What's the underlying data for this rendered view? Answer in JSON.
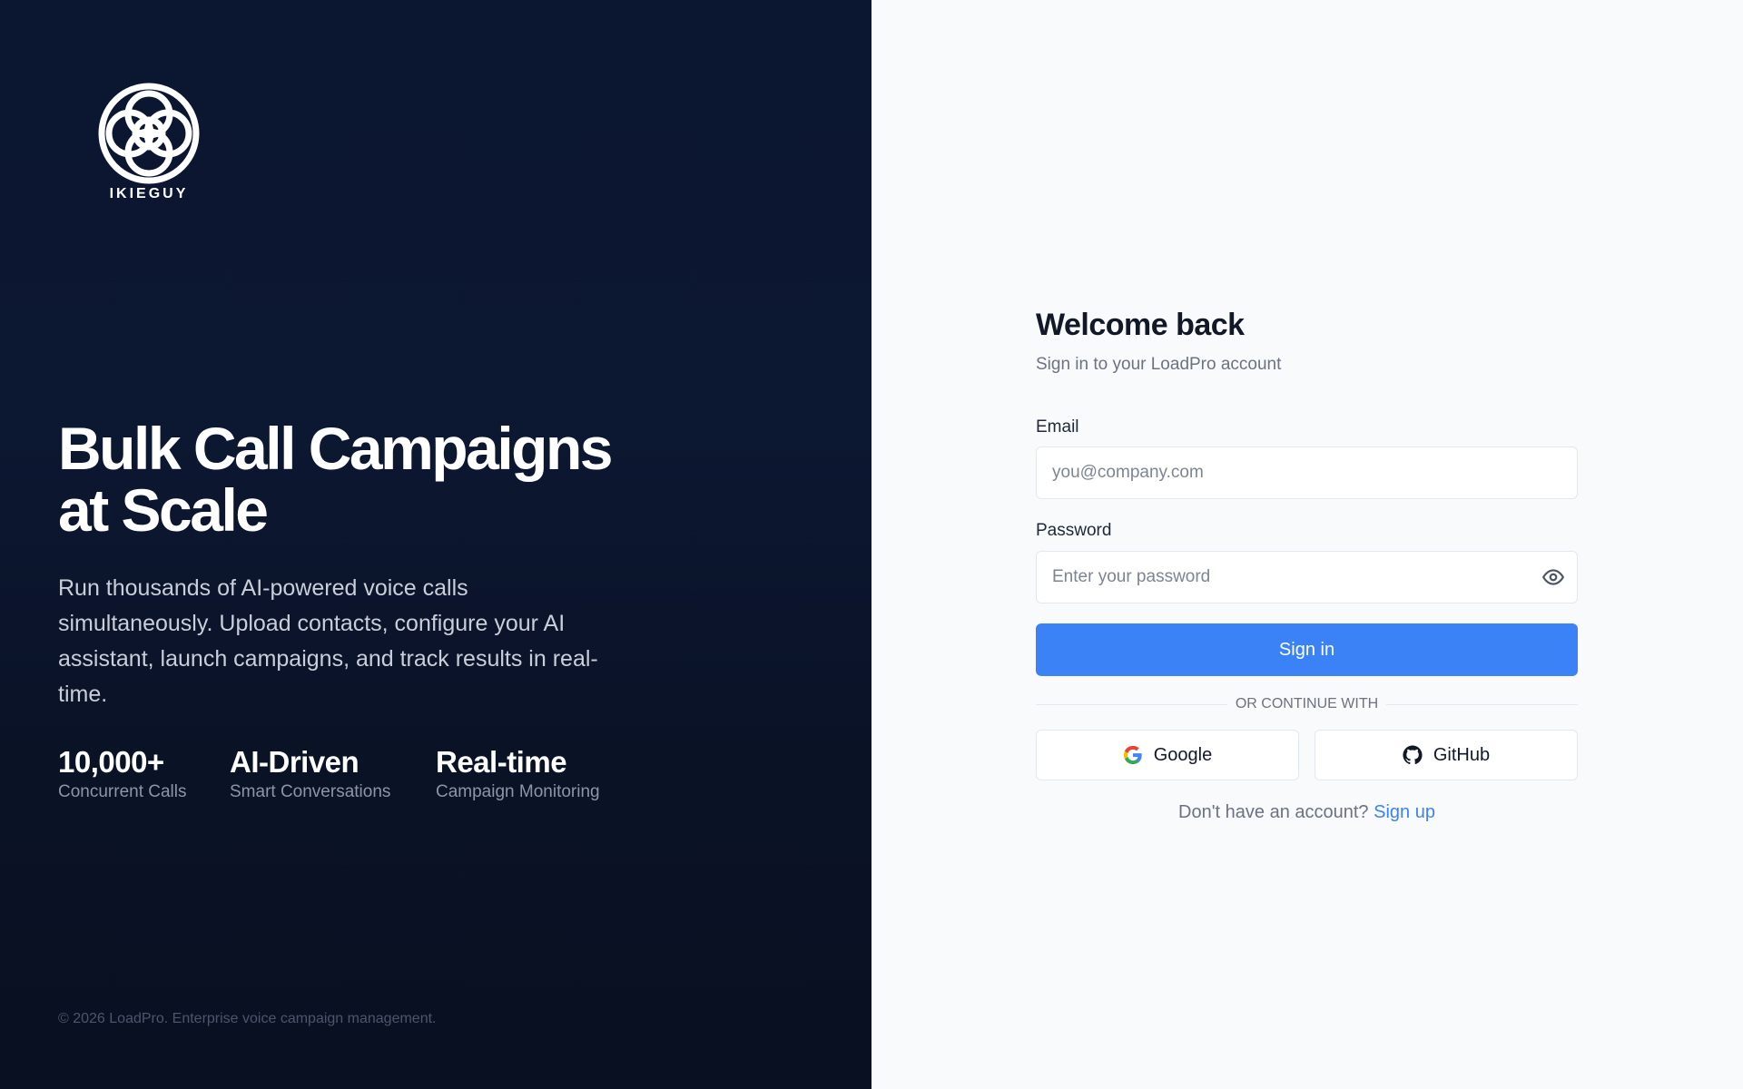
{
  "brand": {
    "logo_text": "IKIEGUY"
  },
  "hero": {
    "title_line1": "Bulk Call Campaigns",
    "title_line2": "at Scale",
    "description": "Run thousands of AI-powered voice calls simultaneously. Upload contacts, configure your AI assistant, launch campaigns, and track results in real-time."
  },
  "stats": [
    {
      "value": "10,000+",
      "label": "Concurrent Calls"
    },
    {
      "value": "AI-Driven",
      "label": "Smart Conversations"
    },
    {
      "value": "Real-time",
      "label": "Campaign Monitoring"
    }
  ],
  "footer": {
    "text": "© 2026 LoadPro. Enterprise voice campaign management."
  },
  "form": {
    "title": "Welcome back",
    "subtitle": "Sign in to your LoadPro account",
    "email_label": "Email",
    "email_placeholder": "you@company.com",
    "email_value": "",
    "password_label": "Password",
    "password_placeholder": "Enter your password",
    "password_value": "",
    "password_toggle_icon": "eye-icon",
    "submit_label": "Sign in",
    "divider_text": "OR CONTINUE WITH",
    "google_label": "Google",
    "github_label": "GitHub",
    "signup_prompt": "Don't have an account?",
    "signup_link": "Sign up"
  },
  "colors": {
    "left_bg": "#0b1630",
    "right_bg": "#f8fafc",
    "accent": "#3b82f6",
    "heading": "#111827",
    "muted": "#6b7280"
  }
}
